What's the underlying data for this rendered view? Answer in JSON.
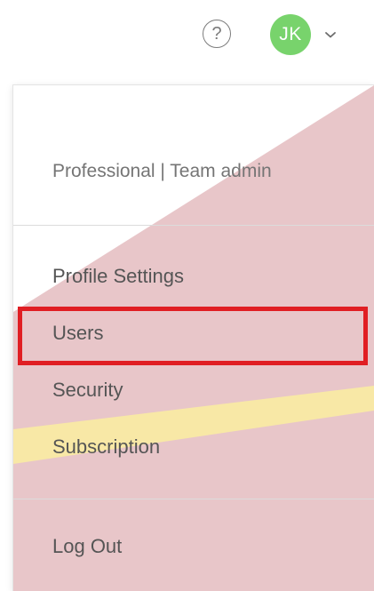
{
  "header": {
    "help_icon_glyph": "?",
    "avatar_initials": "JK",
    "avatar_color": "#78d36c"
  },
  "dropdown": {
    "plan_label": "Professional | Team admin",
    "items": [
      {
        "id": "profile-settings",
        "label": "Profile Settings"
      },
      {
        "id": "users",
        "label": "Users",
        "highlighted": true
      },
      {
        "id": "security",
        "label": "Security"
      },
      {
        "id": "subscription",
        "label": "Subscription"
      }
    ],
    "logout_label": "Log Out"
  },
  "colors": {
    "highlight_border": "#e01e23",
    "overlay_pink": "#e8c6c9",
    "overlay_yellow": "#f8e8a6",
    "text": "#555555"
  }
}
